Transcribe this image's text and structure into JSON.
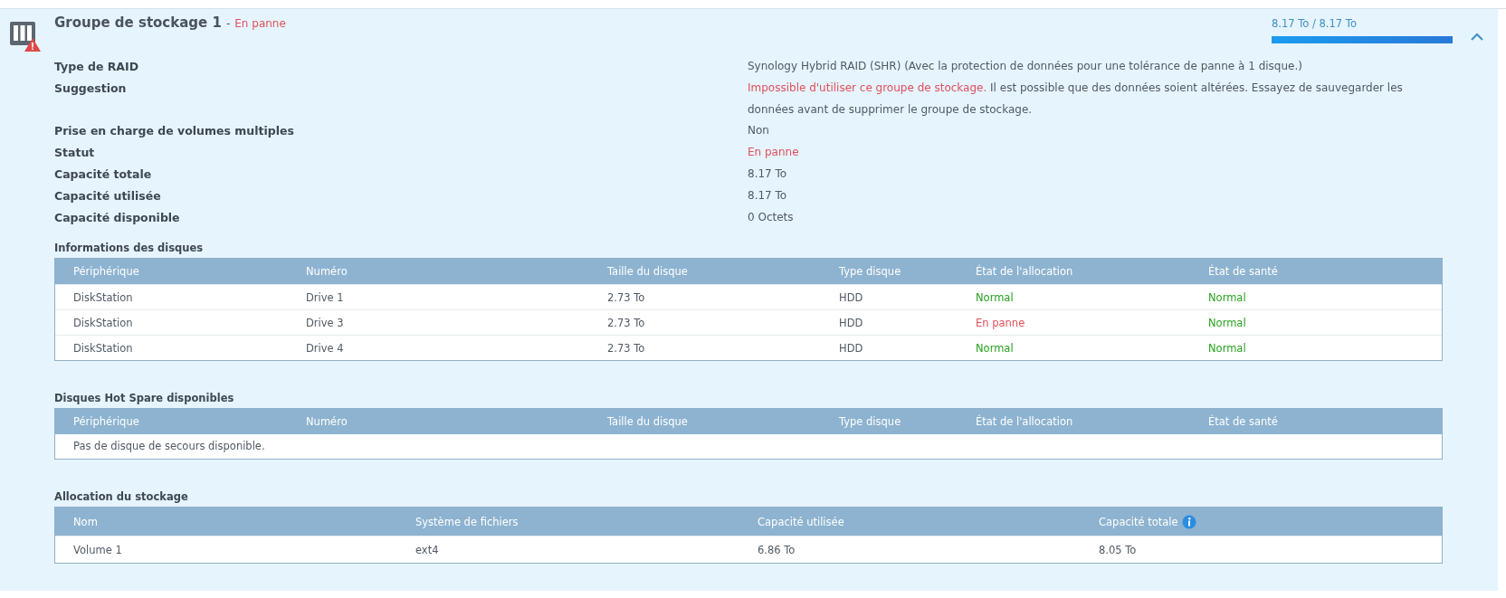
{
  "pool": {
    "title": "Groupe de stockage 1",
    "separator": "-",
    "status": "En panne",
    "usage": "8.17 To / 8.17 To",
    "level": 1.0,
    "expanded": true
  },
  "info": [
    {
      "label": "Type de RAID",
      "parts": [
        {
          "text": "Synology Hybrid RAID (SHR) (Avec la protection de données pour une tolérance de panne à 1 disque.)",
          "alert": false
        }
      ]
    },
    {
      "label": "Suggestion",
      "parts": [
        {
          "text": "Impossible d'utiliser ce groupe de stockage.",
          "alert": true
        },
        {
          "text": " Il est possible que des données soient altérées. Essayez de sauvegarder les données avant de supprimer le groupe de stockage.",
          "alert": false
        }
      ]
    },
    {
      "label": "Prise en charge de volumes multiples",
      "parts": [
        {
          "text": "Non",
          "alert": false
        }
      ]
    },
    {
      "label": "Statut",
      "parts": [
        {
          "text": "En panne",
          "alert": true
        }
      ]
    },
    {
      "label": "Capacité totale",
      "parts": [
        {
          "text": "8.17 To",
          "alert": false
        }
      ]
    },
    {
      "label": "Capacité utilisée",
      "parts": [
        {
          "text": "8.17 To",
          "alert": false
        }
      ]
    },
    {
      "label": "Capacité disponible",
      "parts": [
        {
          "text": "0 Octets",
          "alert": false
        }
      ]
    }
  ],
  "disk_info": {
    "title": "Informations des disques",
    "columns": [
      "Périphérique",
      "Numéro",
      "Taille du disque",
      "Type disque",
      "État de l'allocation",
      "État de santé"
    ],
    "rows": [
      {
        "cells": [
          "DiskStation",
          "Drive 1",
          "2.73 To",
          "HDD"
        ],
        "allocation": {
          "text": "Normal",
          "color": "#27a11e"
        },
        "health": {
          "text": "Normal",
          "color": "#27a11e"
        }
      },
      {
        "cells": [
          "DiskStation",
          "Drive 3",
          "2.73 To",
          "HDD"
        ],
        "allocation": {
          "text": "En panne",
          "color": "#e0505a"
        },
        "health": {
          "text": "Normal",
          "color": "#27a11e"
        }
      },
      {
        "cells": [
          "DiskStation",
          "Drive 4",
          "2.73 To",
          "HDD"
        ],
        "allocation": {
          "text": "Normal",
          "color": "#27a11e"
        },
        "health": {
          "text": "Normal",
          "color": "#27a11e"
        }
      }
    ]
  },
  "hot_spare": {
    "title": "Disques Hot Spare disponibles",
    "columns": [
      "Périphérique",
      "Numéro",
      "Taille du disque",
      "Type disque",
      "État de l'allocation",
      "État de santé"
    ],
    "empty_message": "Pas de disque de secours disponible."
  },
  "allocation": {
    "title": "Allocation du stockage",
    "columns": [
      "Nom",
      "Système de fichiers",
      "Capacité utilisée",
      "Capacité totale"
    ],
    "rows": [
      {
        "cells": [
          "Volume 1",
          "ext4",
          "6.86 To",
          "8.05 To"
        ]
      }
    ]
  }
}
